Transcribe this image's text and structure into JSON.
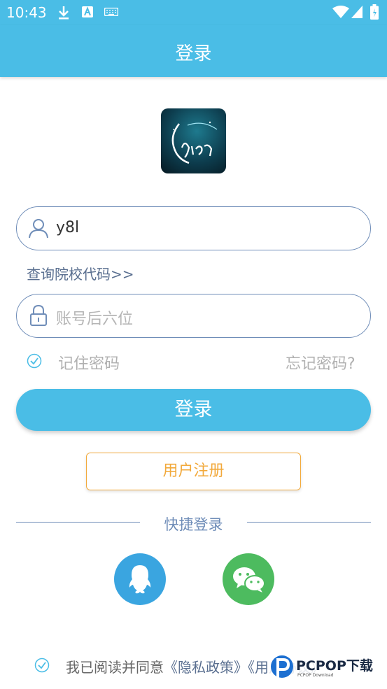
{
  "status_bar": {
    "time": "10:43"
  },
  "header": {
    "title": "登录"
  },
  "account": {
    "value": "y8l"
  },
  "query_school_link": "查询院校代码>>",
  "password": {
    "placeholder": "账号后六位"
  },
  "remember": {
    "label": "记住密码"
  },
  "forgot_link": "忘记密码?",
  "login_button": "登录",
  "register_button": "用户注册",
  "quick_login": {
    "label": "快捷登录"
  },
  "agreement": {
    "prefix": "我已阅读并同意",
    "privacy": "《隐私政策》",
    "user": "《用户协议》"
  },
  "watermark": {
    "brand": "PCPOP下载",
    "sub": "PCPOP Download"
  },
  "colors": {
    "primary": "#4ABDE6",
    "register": "#F2A93B",
    "qq": "#3AA5E0",
    "wechat": "#4DBB5F"
  }
}
